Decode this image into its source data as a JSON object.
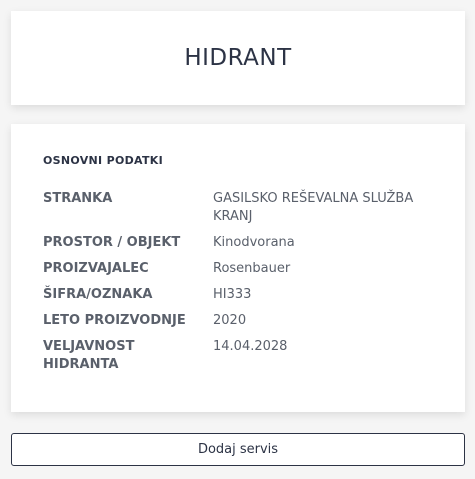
{
  "header": {
    "title": "HIDRANT"
  },
  "details": {
    "section_title": "OSNOVNI PODATKI",
    "rows": [
      {
        "label": "STRANKA",
        "value": "GASILSKO REŠEVALNA SLUŽBA KRANJ"
      },
      {
        "label": "PROSTOR / OBJEKT",
        "value": "Kinodvorana"
      },
      {
        "label": "PROIZVAJALEC",
        "value": "Rosenbauer"
      },
      {
        "label": "ŠIFRA/OZNAKA",
        "value": "HI333"
      },
      {
        "label": "LETO PROIZVODNJE",
        "value": "2020"
      },
      {
        "label": "VELJAVNOST HIDRANTA",
        "value": "14.04.2028"
      }
    ]
  },
  "actions": {
    "add_service_label": "Dodaj servis"
  }
}
